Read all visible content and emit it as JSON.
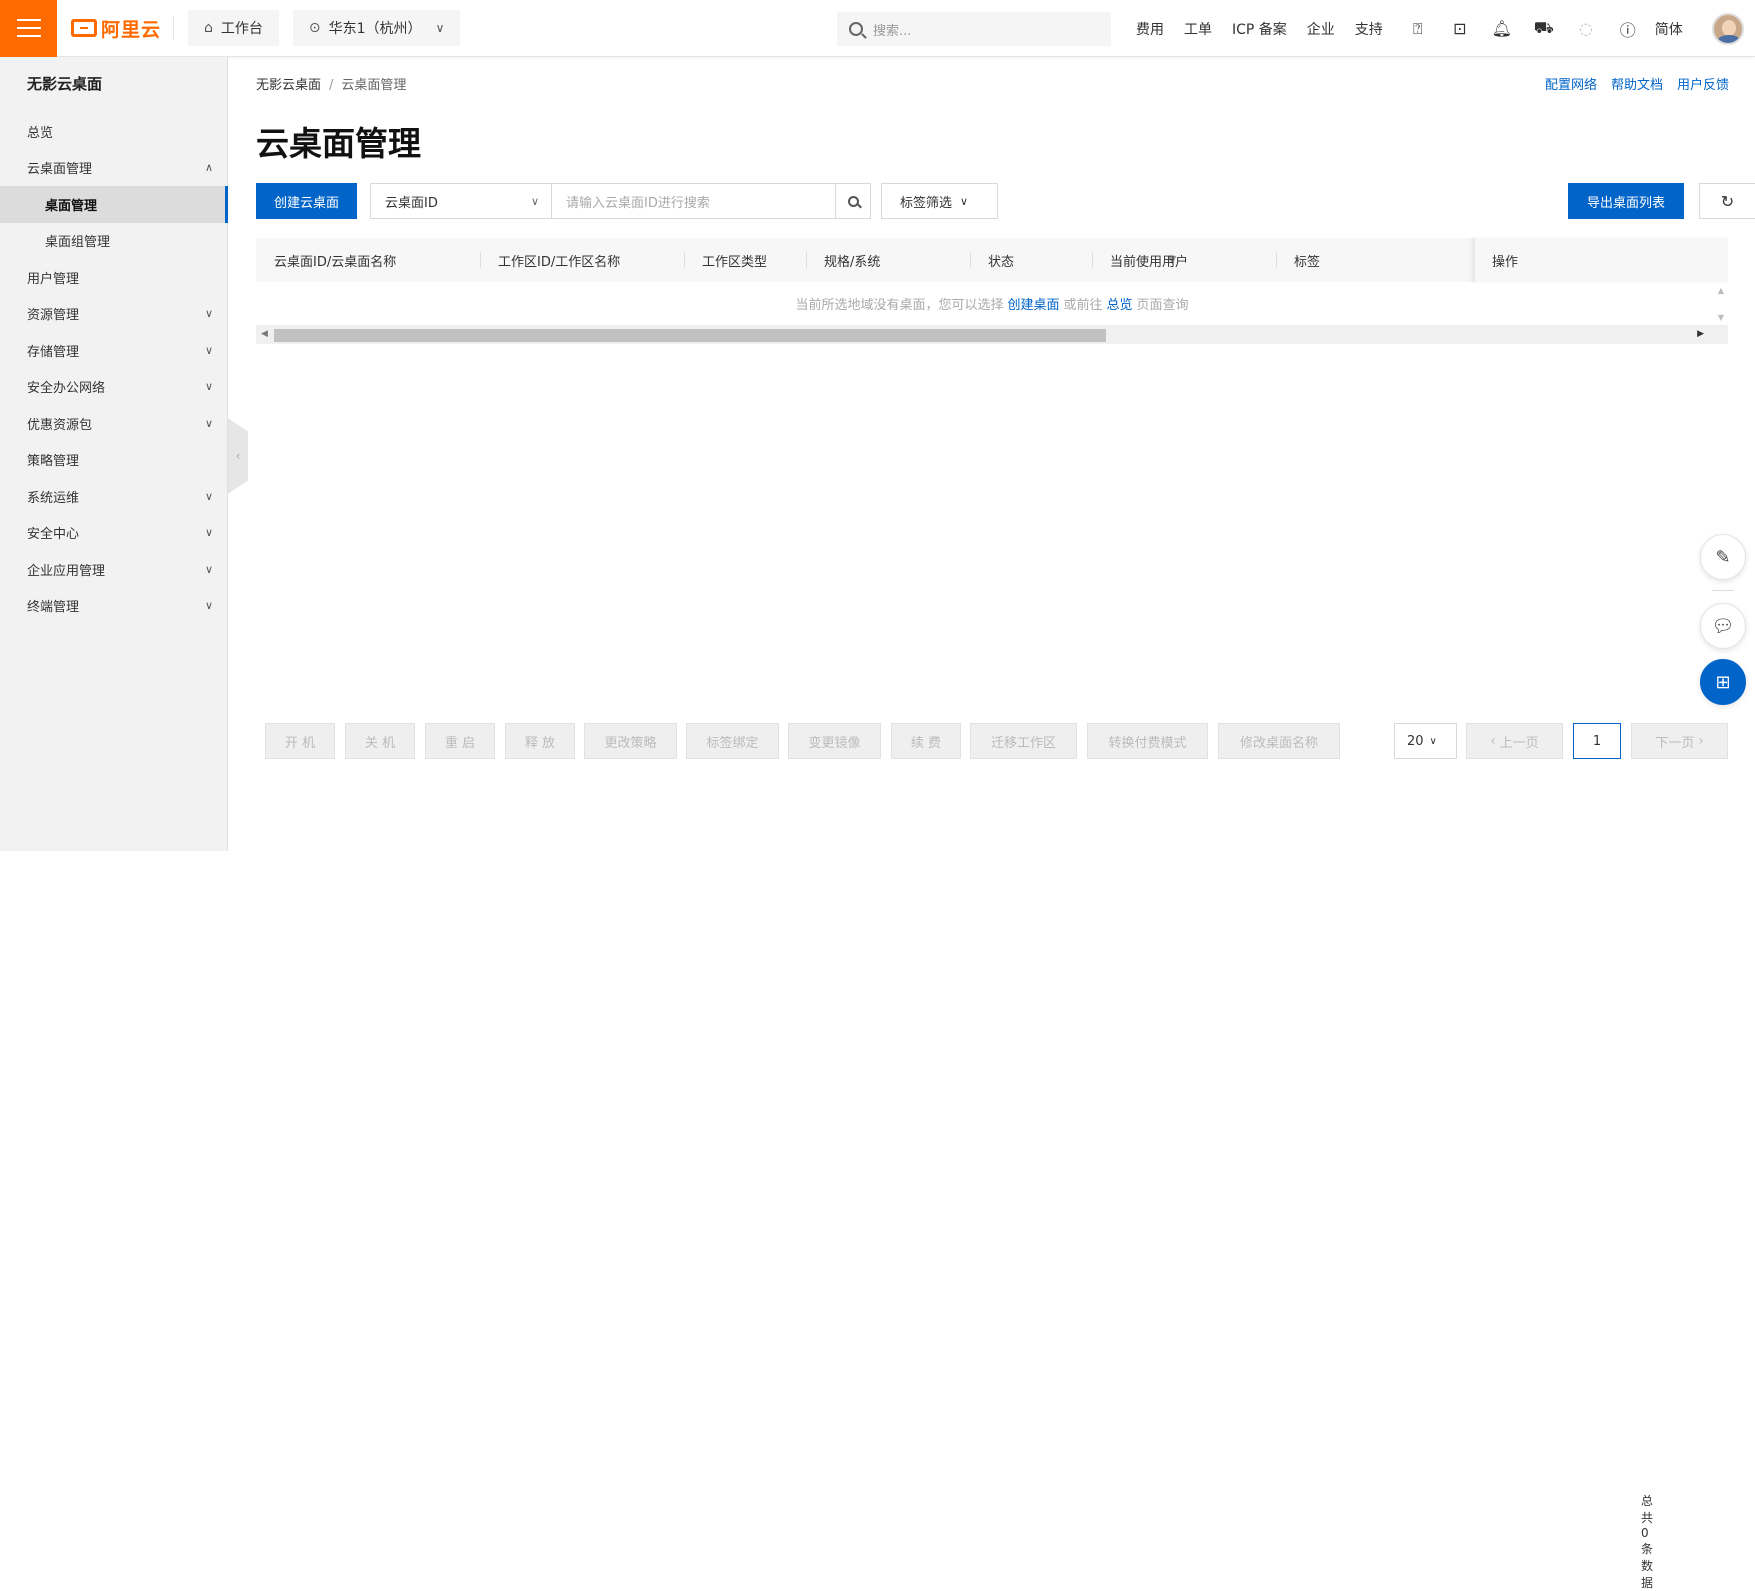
{
  "topbar": {
    "logo": "阿里云",
    "workbench": "工作台",
    "region": "华东1（杭州）",
    "search_placeholder": "搜索...",
    "links": [
      "费用",
      "工单",
      "ICP 备案",
      "企业",
      "支持"
    ],
    "lang": "简体"
  },
  "sidebar": {
    "title": "无影云桌面",
    "items": [
      {
        "label": "总览"
      },
      {
        "label": "云桌面管理"
      },
      {
        "label": "桌面管理"
      },
      {
        "label": "桌面组管理"
      },
      {
        "label": "用户管理"
      },
      {
        "label": "资源管理"
      },
      {
        "label": "存储管理"
      },
      {
        "label": "安全办公网络"
      },
      {
        "label": "优惠资源包"
      },
      {
        "label": "策略管理"
      },
      {
        "label": "系统运维"
      },
      {
        "label": "安全中心"
      },
      {
        "label": "企业应用管理"
      },
      {
        "label": "终端管理"
      }
    ]
  },
  "main": {
    "breadcrumb": [
      "无影云桌面",
      "云桌面管理"
    ],
    "help_links": [
      "配置网络",
      "帮助文档",
      "用户反馈"
    ],
    "title": "云桌面管理",
    "create_button": "创建云桌面",
    "filter_select": "云桌面ID",
    "search_placeholder": "请输入云桌面ID进行搜索",
    "tag_filter": "标签筛选",
    "export_button": "导出桌面列表",
    "table": {
      "columns": [
        "云桌面ID/云桌面名称",
        "工作区ID/工作区名称",
        "工作区类型",
        "规格/系统",
        "状态",
        "当前使用用户",
        "标签",
        "操作"
      ],
      "empty_prefix": "当前所选地域没有桌面，您可以选择",
      "empty_link1": "创建桌面",
      "empty_mid": "或前往",
      "empty_link2": "总览",
      "empty_suffix": "页面查询"
    },
    "actions": [
      "开 机",
      "关 机",
      "重 启",
      "释 放",
      "更改策略",
      "标签绑定",
      "变更镜像",
      "续 费",
      "迁移工作区",
      "转换付费模式",
      "修改桌面名称"
    ],
    "pager": {
      "page_size": "20",
      "prev": "上一页",
      "current": "1",
      "next": "下一页",
      "total": "总共0条数据"
    }
  },
  "colors": {
    "brand": "#ff6a00",
    "primary": "#0064c8"
  }
}
